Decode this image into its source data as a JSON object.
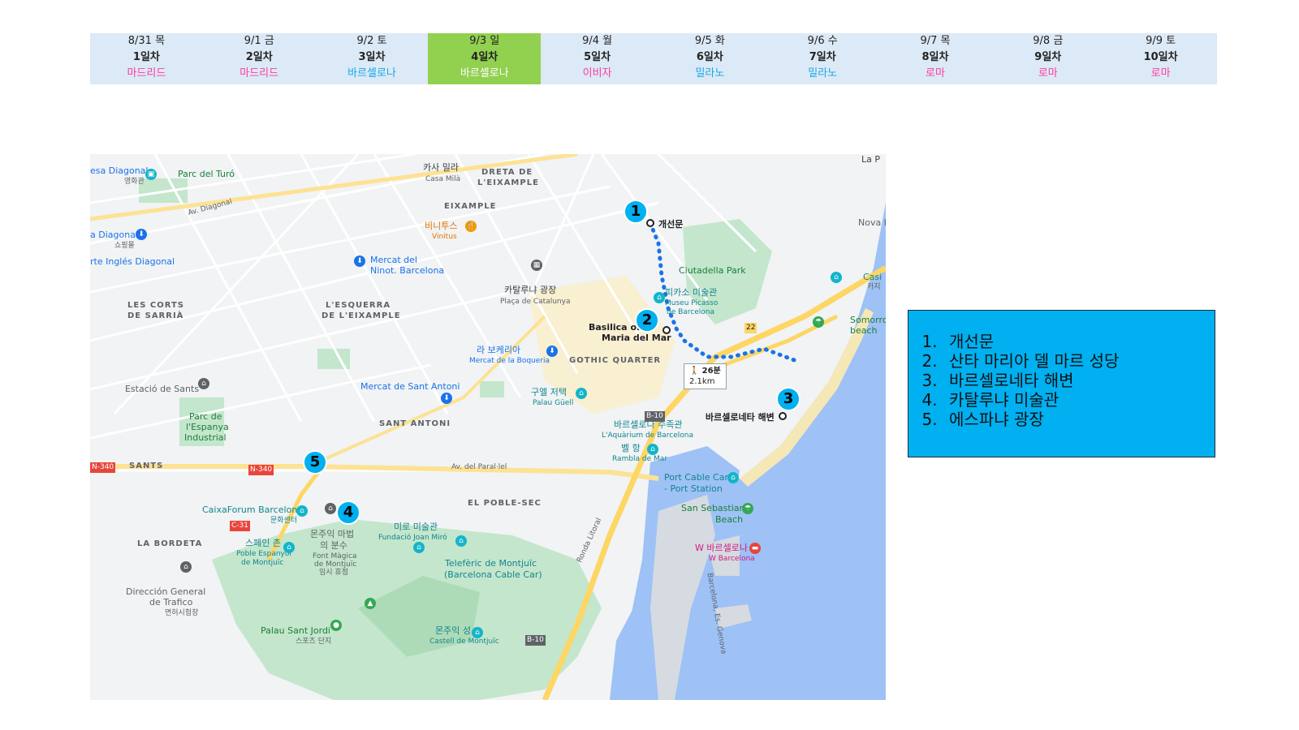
{
  "schedule": [
    {
      "date": "8/31 목",
      "day": "1일차",
      "city": "마드리드",
      "color": "pink",
      "active": false
    },
    {
      "date": "9/1 금",
      "day": "2일차",
      "city": "마드리드",
      "color": "pink",
      "active": false
    },
    {
      "date": "9/2 토",
      "day": "3일차",
      "city": "바르셀로나",
      "color": "blue",
      "active": false
    },
    {
      "date": "9/3 일",
      "day": "4일차",
      "city": "바르셀로나",
      "color": "blue",
      "active": true
    },
    {
      "date": "9/4 월",
      "day": "5일차",
      "city": "이비자",
      "color": "pink",
      "active": false
    },
    {
      "date": "9/5 화",
      "day": "6일차",
      "city": "밀라노",
      "color": "blue",
      "active": false
    },
    {
      "date": "9/6 수",
      "day": "7일차",
      "city": "밀라노",
      "color": "blue",
      "active": false
    },
    {
      "date": "9/7 목",
      "day": "8일차",
      "city": "로마",
      "color": "pink",
      "active": false
    },
    {
      "date": "9/8 금",
      "day": "9일차",
      "city": "로마",
      "color": "pink",
      "active": false
    },
    {
      "date": "9/9 토",
      "day": "10일차",
      "city": "로마",
      "color": "pink",
      "active": false
    }
  ],
  "colors": {
    "header_bg": "#dce9f6",
    "active_day": "#92d050",
    "pink_city": "#ff3aa0",
    "blue_city": "#17a8e6",
    "pin": "#00b0f0",
    "legend_bg": "#00b0f0",
    "route": "#1a73e8",
    "water": "#9ec1f6",
    "park": "#c4e6cc"
  },
  "legend": [
    "개선문",
    "산타 마리아 델 마르 성당",
    "바르셀로네타 해변",
    "카탈루냐 미술관",
    "에스파냐 광장"
  ],
  "map": {
    "pins": [
      "1",
      "2",
      "3",
      "4",
      "5"
    ],
    "walk": {
      "time": "26분",
      "distance": "2.1km"
    },
    "labels": {
      "casa_mila_ko": "카사 밀라",
      "casa_mila": "Casa Milà",
      "dreta": "DRETA DE",
      "eixample1": "L'EIXAMPLE",
      "eixample2": "EIXAMPLE",
      "vinitus_ko": "비니투스",
      "vinitus": "Vinitus",
      "parc_turo": "Parc del Turó",
      "diagonal1": "esa Diagonal",
      "diagonal1b": "영화관",
      "diagonal2": "a Diagonal",
      "diagonal2b": "쇼핑몰",
      "corte": "rte Inglés Diagonal",
      "mercat_ninot1": "Mercat del",
      "mercat_ninot2": "Ninot. Barcelona",
      "les_corts1": "LES CORTS",
      "les_corts2": "DE SARRIÀ",
      "esquerra1": "L'ESQUERRA",
      "esquerra2": "DE L'EIXAMPLE",
      "catalunya_ko": "카탈루냐 광장",
      "catalunya": "Plaça de Catalunya",
      "arc": "개선문",
      "ciutadella": "Ciutadella Park",
      "picasso_ko": "피카소 미술관",
      "picasso1": "Museu Picasso",
      "picasso2": "de Barcelona",
      "basilica1": "Basilica of",
      "basilica2": "Maria del Mar",
      "boqueria_ko": "라 보케리아",
      "boqueria": "Mercat de la Boqueria",
      "gothic": "GOTHIC QUARTER",
      "guell_ko": "구엘 저택",
      "guell": "Palau Güell",
      "sant_antoni_m": "Mercat de Sant Antoni",
      "sant_antoni": "SANT ANTONI",
      "estacio": "Estació de Sants",
      "parc_espanya1": "Parc de",
      "parc_espanya2": "l'Espanya",
      "parc_espanya3": "Industrial",
      "sants": "SANTS",
      "aquarium_ko": "바르셀로나 수족관",
      "aquarium": "L'Aquàrium de Barcelona",
      "rambla_ko": "벨 항",
      "rambla": "Rambla de Mar",
      "barceloneta_beach": "바르셀로네타 해변",
      "poble_sec": "EL POBLE-SEC",
      "paral": "Av. del Paral·lel",
      "caixa": "CaixaForum Barcelona",
      "caixa_ko": "문화센터",
      "fountain_ko1": "몬주익 마법",
      "fountain_ko2": "의 분수",
      "fountain1": "Font Màgica",
      "fountain2": "de Montjuïc",
      "fountain3": "임시 휴점",
      "miro_ko": "미로 미술관",
      "miro": "Fundació Joan Miró",
      "poble_esp_ko": "스페인 촌",
      "poble_esp1": "Poble Espanyol",
      "poble_esp2": "de Montjuïc",
      "bordeta": "LA BORDETA",
      "teleferic1": "Telefèric de Montjuïc",
      "teleferic2": "(Barcelona Cable Car)",
      "direccion1": "Dirección General",
      "direccion2": "de Trafico",
      "direccion3": "면허시험장",
      "palau_jordi": "Palau Sant Jordi",
      "palau_jordi_ko": "스포츠 단지",
      "castell_ko": "몬주익 성",
      "castell": "Castell de Montjuïc",
      "port_cable1": "Port Cable Car",
      "port_cable2": "- Port Station",
      "san_sebastian1": "San Sebastian",
      "san_sebastian2": "Beach",
      "w_hotel_ko": "W 바르셀로나",
      "w_hotel": "W Barcelona",
      "somorrostro1": "Somorro",
      "somorrostro2": "beach",
      "nova": "Nova I",
      "casino": "Casi",
      "casino_ko": "카지",
      "la_p": "La P",
      "ronda": "Ronda Litoral",
      "moll": "Barcelona, Es. Genova",
      "av_diagonal": "Av. Diagonal",
      "n340": "N-340",
      "b10": "B-10",
      "c31": "C-31",
      "r22": "22"
    }
  }
}
